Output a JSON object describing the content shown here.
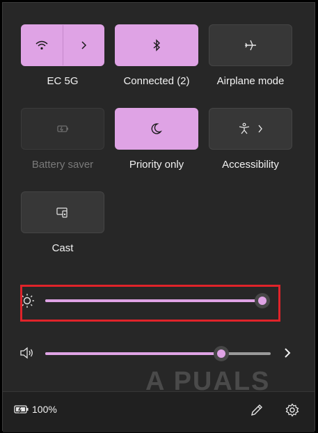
{
  "tiles": {
    "wifi": {
      "label": "EC 5G",
      "icon": "wifi-icon",
      "state": "on"
    },
    "bluetooth": {
      "label": "Connected (2)",
      "icon": "bluetooth-icon",
      "state": "on"
    },
    "airplane": {
      "label": "Airplane mode",
      "icon": "airplane-icon",
      "state": "off"
    },
    "battery_saver": {
      "label": "Battery saver",
      "icon": "battery-saver-icon",
      "state": "disabled"
    },
    "focus": {
      "label": "Priority only",
      "icon": "moon-icon",
      "state": "on"
    },
    "accessibility": {
      "label": "Accessibility",
      "icon": "accessibility-icon",
      "state": "off"
    },
    "cast": {
      "label": "Cast",
      "icon": "cast-icon",
      "state": "off"
    }
  },
  "sliders": {
    "brightness": {
      "icon": "brightness-icon",
      "level": 1.0
    },
    "volume": {
      "icon": "speaker-icon",
      "level": 0.78
    }
  },
  "footer": {
    "battery_percent": "100%",
    "battery_icon": "battery-charging-icon",
    "edit_icon": "pencil-icon",
    "settings_icon": "gear-icon"
  },
  "watermark": "A  PUALS",
  "colors": {
    "accent": "#dfa3e5",
    "panel": "#272727",
    "highlight": "#e0232a"
  }
}
